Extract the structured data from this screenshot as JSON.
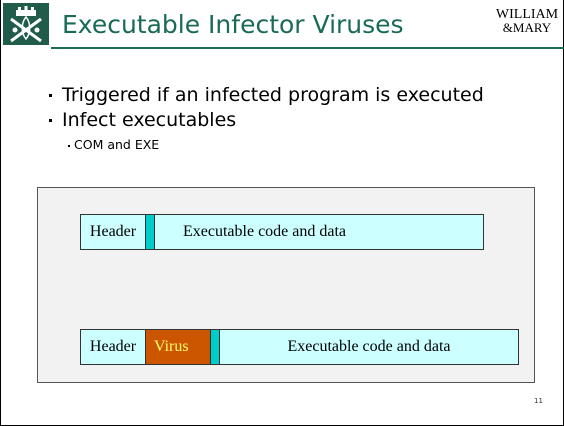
{
  "slide": {
    "title": "Executable Infector Viruses",
    "logo_line1": "WILLIAM",
    "logo_line2": "&MARY",
    "bullets": [
      "Triggered if an infected program is executed",
      "Infect executables"
    ],
    "sub_bullets": [
      "COM and EXE"
    ],
    "slide_number": "11"
  },
  "diagram": {
    "original_file": {
      "header": "Header",
      "body": "Executable code and data"
    },
    "infected_file": {
      "header": "Header",
      "virus": "Virus",
      "body": "Executable code and data"
    }
  },
  "colors": {
    "title_green": "#1a6b55",
    "logo_green": "#215b4a",
    "light_cyan": "#ccffff",
    "marker_cyan": "#00cccc",
    "virus_orange": "#cc5500",
    "virus_text": "#ffff66"
  }
}
